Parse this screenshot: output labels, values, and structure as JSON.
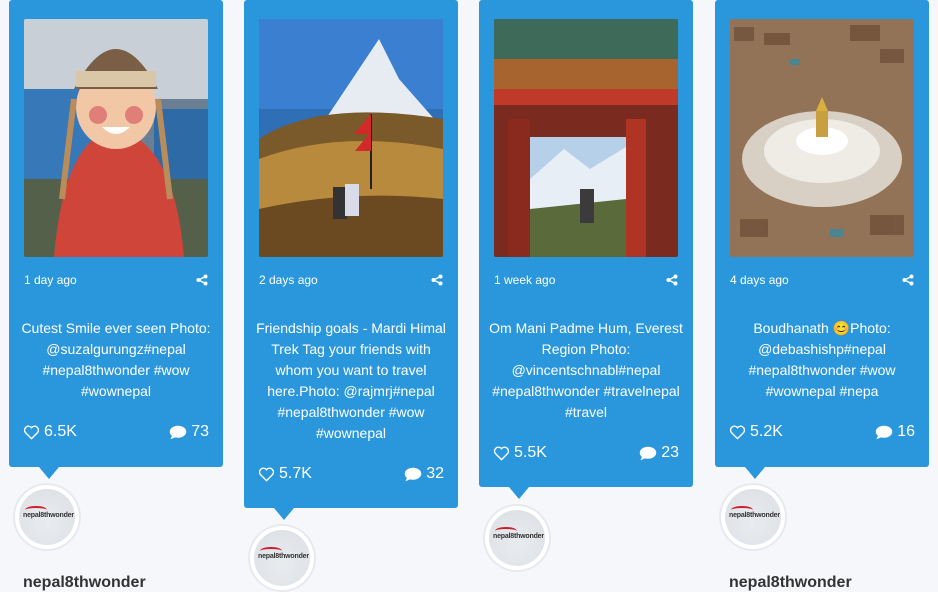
{
  "posts": [
    {
      "time": "1 day ago",
      "caption": "Cutest Smile ever seen Photo: @suzalgurungz#nepal #nepal8thwonder #wow #wownepal",
      "likes": "6.5K",
      "comments": "73",
      "user": "nepal8thwonder",
      "avatar_logo": "nepal8thwonder"
    },
    {
      "time": "2 days ago",
      "caption": "Friendship goals - Mardi Himal Trek Tag your friends with whom you want to travel here.Photo: @rajmrj#nepal #nepal8thwonder #wow #wownepal",
      "likes": "5.7K",
      "comments": "32",
      "user": "",
      "avatar_logo": "nepal8thwonder"
    },
    {
      "time": "1 week ago",
      "caption": "Om Mani Padme Hum, Everest Region Photo: @vincentschnabl#nepal #nepal8thwonder #travelnepal #travel",
      "likes": "5.5K",
      "comments": "23",
      "user": "",
      "avatar_logo": "nepal8thwonder"
    },
    {
      "time": "4 days ago",
      "caption": "Boudhanath 😊Photo: @debashishp#nepal #nepal8thwonder #wow #wownepal #nepa",
      "likes": "5.2K",
      "comments": "16",
      "user": "nepal8thwonder",
      "avatar_logo": "nepal8thwonder"
    }
  ],
  "colors": {
    "card": "#2a97dd",
    "background": "#f5f7fa"
  },
  "icons": {
    "share": "share-icon",
    "like": "heart-icon",
    "comment": "comment-icon"
  }
}
